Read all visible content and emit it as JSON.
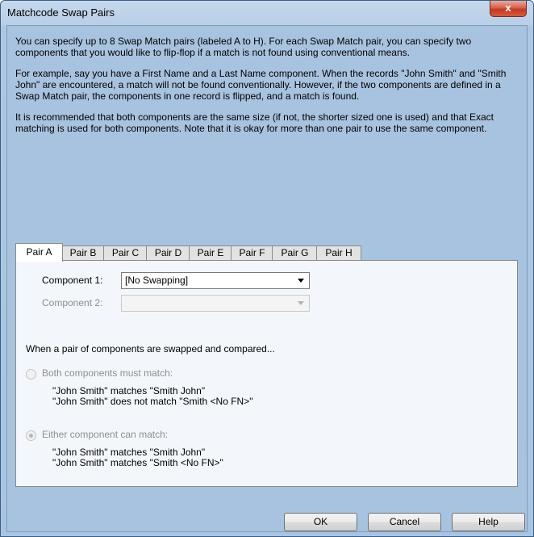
{
  "window": {
    "title": "Matchcode Swap Pairs",
    "close_symbol": "x"
  },
  "description": {
    "p1": "You can specify up to 8 Swap Match pairs (labeled A to H). For each Swap Match pair, you can specify two components that you would like to flip-flop if a match is not found using conventional means.",
    "p2": "For example, say you have a First Name and a Last Name component. When the records \"John Smith\" and \"Smith John\" are encountered, a match will not be found conventionally. However, if the two components are defined in a Swap Match pair, the components in one record is flipped, and a match is found.",
    "p3": "It is recommended that both components are the same size (if not, the shorter sized one is used) and that Exact matching is used for both components. Note that it is okay for more than one pair to use the same component."
  },
  "tabs": [
    "Pair A",
    "Pair B",
    "Pair C",
    "Pair D",
    "Pair E",
    "Pair F",
    "Pair G",
    "Pair H"
  ],
  "active_tab": "Pair A",
  "panel": {
    "component1_label": "Component 1:",
    "component1_value": "[No Swapping]",
    "component2_label": "Component 2:",
    "component2_value": "",
    "compare_heading": "When a pair of components are swapped and compared...",
    "option_both": {
      "label": "Both components must match:",
      "example1": "\"John Smith\" matches \"Smith John\"",
      "example2": "\"John Smith\" does not match \"Smith <No FN>\"",
      "checked": false
    },
    "option_either": {
      "label": "Either component can match:",
      "example1": "\"John Smith\" matches \"Smith John\"",
      "example2": "\"John Smith\" matches \"Smith <No FN>\"",
      "checked": true
    }
  },
  "buttons": {
    "ok": "OK",
    "cancel": "Cancel",
    "help": "Help"
  }
}
